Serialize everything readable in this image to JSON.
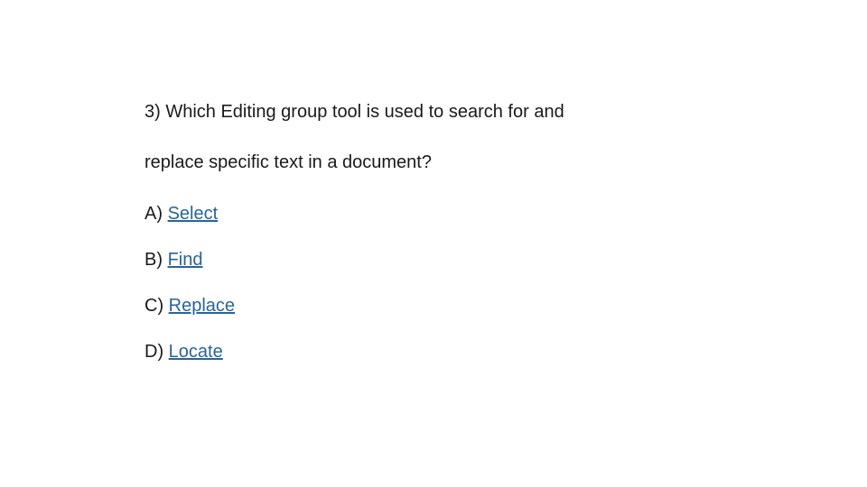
{
  "question": {
    "line1": "3) Which Editing group tool is used to search for and",
    "line2": "replace specific text in a document?"
  },
  "options": [
    {
      "label": "A) ",
      "link": "Select"
    },
    {
      "label": "B) ",
      "link": "Find"
    },
    {
      "label": "C) ",
      "link": "Replace"
    },
    {
      "label": "D) ",
      "link": "Locate"
    }
  ]
}
